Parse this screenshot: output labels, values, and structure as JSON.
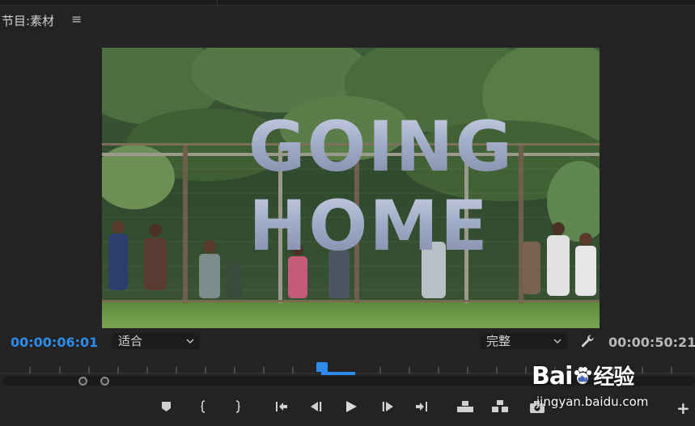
{
  "panel": {
    "title": "节目:素材",
    "menu_glyph": "≡"
  },
  "video": {
    "title_line1": "GOING",
    "title_line2": "HOME"
  },
  "timecodes": {
    "current": "00:00:06:01",
    "duration": "00:00:50:21"
  },
  "zoom_select": {
    "value": "适合"
  },
  "quality_select": {
    "value": "完整"
  },
  "watermark": {
    "brand": "Bai",
    "brand_du": "du",
    "brand_cn": "经验",
    "url": "jingyan.baidu.com"
  },
  "colors": {
    "accent": "#2d8ceb",
    "background": "#232323"
  },
  "controls": [
    "add-marker",
    "mark-in",
    "mark-out",
    "go-to-in",
    "step-back",
    "play",
    "step-forward",
    "go-to-out",
    "lift",
    "extract",
    "export-frame",
    "button-editor"
  ]
}
